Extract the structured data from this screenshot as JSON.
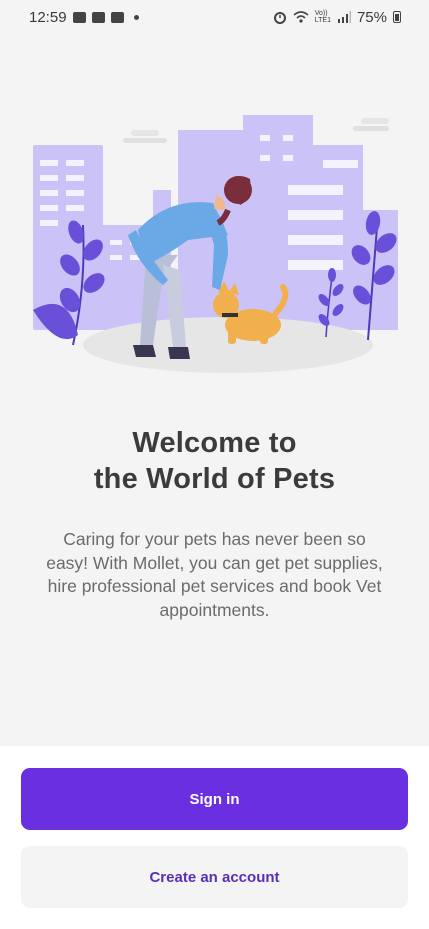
{
  "status_bar": {
    "time": "12:59",
    "battery": "75%",
    "icons": [
      "mail-icon",
      "image-icon",
      "notification-icon",
      "dot-icon",
      "alarm-icon",
      "wifi-icon",
      "volte-icon",
      "signal-icon",
      "battery-icon"
    ],
    "volte_label": "Vo))\nLTE1"
  },
  "welcome": {
    "title_line1": "Welcome to",
    "title_line2": "the World of Pets",
    "description": "Caring for your pets has never been so easy! With Mollet, you can get pet supplies, hire professional pet services and book Vet appointments."
  },
  "actions": {
    "sign_in": "Sign in",
    "create_account": "Create an account"
  },
  "colors": {
    "primary": "#6a2fe0",
    "secondary_text": "#5a2fb8",
    "illustration_city": "#cbc3f7",
    "illustration_plant": "#6a4fd8",
    "dog": "#f1b04d"
  }
}
